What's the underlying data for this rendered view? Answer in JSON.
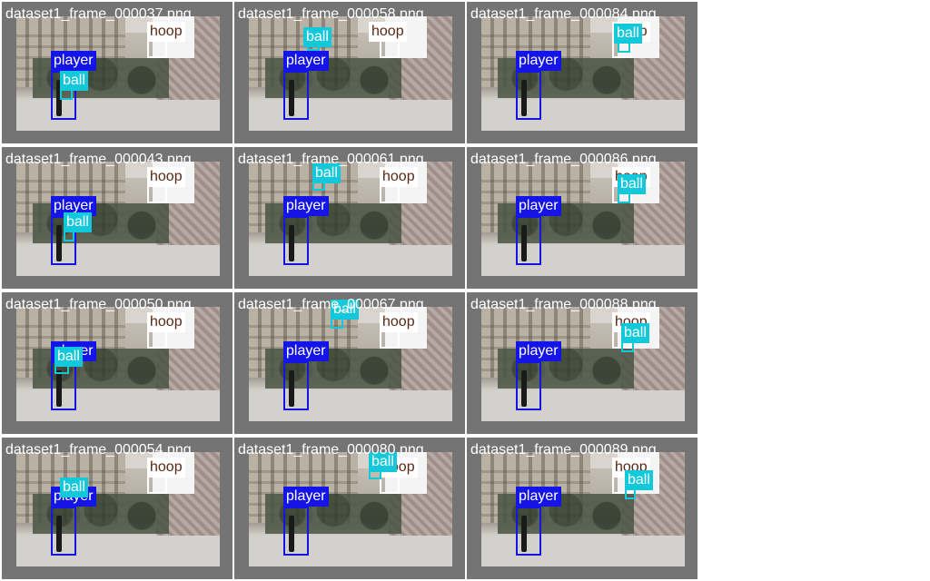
{
  "colors": {
    "player": "#1414e6",
    "ball": "#14c8dc",
    "hoop": "#ffffff",
    "hoop_text": "#5a2814",
    "tile_bg": "#747474"
  },
  "class_labels": {
    "player": "player",
    "ball": "ball",
    "hoop": "hoop"
  },
  "tiles": [
    {
      "file": "dataset1_frame_000037.png",
      "detections": [
        "player",
        "ball",
        "hoop"
      ]
    },
    {
      "file": "dataset1_frame_000058.png",
      "detections": [
        "player",
        "ball",
        "hoop"
      ]
    },
    {
      "file": "dataset1_frame_000084.png",
      "detections": [
        "player",
        "ball",
        "hoop"
      ]
    },
    {
      "file": "dataset1_frame_000043.png",
      "detections": [
        "player",
        "ball",
        "hoop"
      ]
    },
    {
      "file": "dataset1_frame_000061.png",
      "detections": [
        "player",
        "ball",
        "hoop"
      ]
    },
    {
      "file": "dataset1_frame_000086.png",
      "detections": [
        "player",
        "ball",
        "hoop"
      ]
    },
    {
      "file": "dataset1_frame_000050.png",
      "detections": [
        "player",
        "ball",
        "hoop"
      ]
    },
    {
      "file": "dataset1_frame_000067.png",
      "detections": [
        "player",
        "ball",
        "hoop"
      ]
    },
    {
      "file": "dataset1_frame_000088.png",
      "detections": [
        "player",
        "ball",
        "hoop"
      ]
    },
    {
      "file": "dataset1_frame_000054.png",
      "detections": [
        "player",
        "ball",
        "hoop"
      ]
    },
    {
      "file": "dataset1_frame_000080.png",
      "detections": [
        "player",
        "ball",
        "hoop"
      ]
    },
    {
      "file": "dataset1_frame_000089.png",
      "detections": [
        "player",
        "ball",
        "hoop"
      ]
    }
  ]
}
